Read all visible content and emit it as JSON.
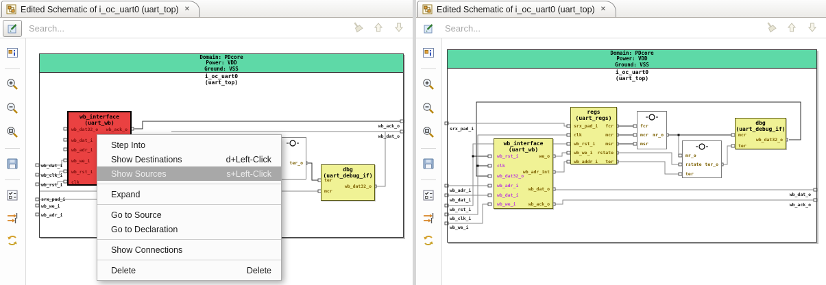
{
  "colors": {
    "domain_green": "#5ed9a7",
    "block_red": "#ea4141",
    "block_yellow": "#f0f295",
    "menu_highlight": "#a8a8a8",
    "port_magenta": "#bb3fd9",
    "port_olive": "#7c6000",
    "port_maroon": "#7e0f0f"
  },
  "icons": {
    "tab_close": "✕"
  },
  "panels": [
    {
      "tab_title": "Edited Schematic of i_oc_uart0 (uart_top)",
      "search_placeholder": "Search...",
      "schematic": {
        "domain_lines": [
          "Domain: PDcore",
          "Power: VDD",
          "Ground: VSS"
        ],
        "instance_lines": [
          "i_oc_uart0",
          "(uart_top)"
        ],
        "blocks": {
          "wb_interface": {
            "title": "wb_interface",
            "subtitle": "(uart_wb)",
            "left_ports": [
              "wb_dat32_o",
              "wb_dat_i",
              "wb_adr_i",
              "wb_we_i",
              "wb_rst_i",
              "clk"
            ],
            "right_ports": [
              "wb_ack_o"
            ]
          },
          "sym1": {
            "right_ports": [
              "ter_o"
            ]
          },
          "dbg": {
            "title": "dbg",
            "subtitle": "(uart_debug_if)",
            "left_ports": [
              "ter",
              "mcr"
            ],
            "right_ports": [
              "wb_dat32_o"
            ]
          }
        },
        "left_edge_labels": [
          "wb_dat_i",
          "wb_clk_i",
          "wb_rst_i",
          "srx_pad_i",
          "wb_we_i",
          "wb_adr_i"
        ],
        "right_edge_labels": [
          "wb_ack_o",
          "wb_dat_o"
        ]
      },
      "context_menu": {
        "items": [
          {
            "label": "Step Into",
            "shortcut": ""
          },
          {
            "label": "Show Destinations",
            "shortcut": "d+Left-Click"
          },
          {
            "label": "Show Sources",
            "shortcut": "s+Left-Click"
          },
          {
            "label": "Expand",
            "shortcut": ""
          },
          {
            "label": "Go to Source",
            "shortcut": ""
          },
          {
            "label": "Go to Declaration",
            "shortcut": ""
          },
          {
            "label": "Show Connections",
            "shortcut": ""
          },
          {
            "label": "Delete",
            "shortcut": "Delete"
          }
        ]
      }
    },
    {
      "tab_title": "Edited Schematic of i_oc_uart0 (uart_top)",
      "search_placeholder": "Search...",
      "schematic": {
        "domain_lines": [
          "Domain: PDcore",
          "Power: VDD",
          "Ground: VSS"
        ],
        "instance_lines": [
          "i_oc_uart0",
          "(uart_top)"
        ],
        "blocks": {
          "wb_interface": {
            "title": "wb_interface",
            "subtitle": "(uart_wb)",
            "left_ports": [
              "wb_rst_i",
              "clk",
              "wb_dat32_o",
              "wb_adr_i",
              "wb_dat_i",
              "wb_we_i"
            ],
            "right_ports": [
              "we_o",
              "wb_adr_int",
              "wb_dat_o",
              "wb_ack_o"
            ]
          },
          "regs": {
            "title": "regs",
            "subtitle": "(uart_regs)",
            "left_ports": [
              "srx_pad_i",
              "clk",
              "wb_rst_i",
              "wb_we_i",
              "wb_addr_i"
            ],
            "right_ports": [
              "fcr",
              "mcr",
              "msr",
              "rstate",
              "ter"
            ]
          },
          "sym1": {
            "left_ports": [
              "fcr",
              "mcr",
              "msr"
            ],
            "right_ports": [
              "mr_o"
            ]
          },
          "sym2": {
            "left_ports": [
              "mr_o",
              "rstate",
              "ter"
            ],
            "right_ports": [
              "ter_o"
            ]
          },
          "dbg": {
            "title": "dbg",
            "subtitle": "(uart_debug_if)",
            "left_ports": [
              "mcr",
              "ter"
            ],
            "right_ports": [
              "wb_dat32_o"
            ]
          }
        },
        "left_edge_labels": [
          "srx_pad_i",
          "wb_adr_i",
          "wb_dat_i",
          "wb_rst_i",
          "wb_clk_i",
          "wb_we_i"
        ],
        "right_edge_labels": [
          "wb_dat_o",
          "wb_ack_o"
        ]
      }
    }
  ]
}
